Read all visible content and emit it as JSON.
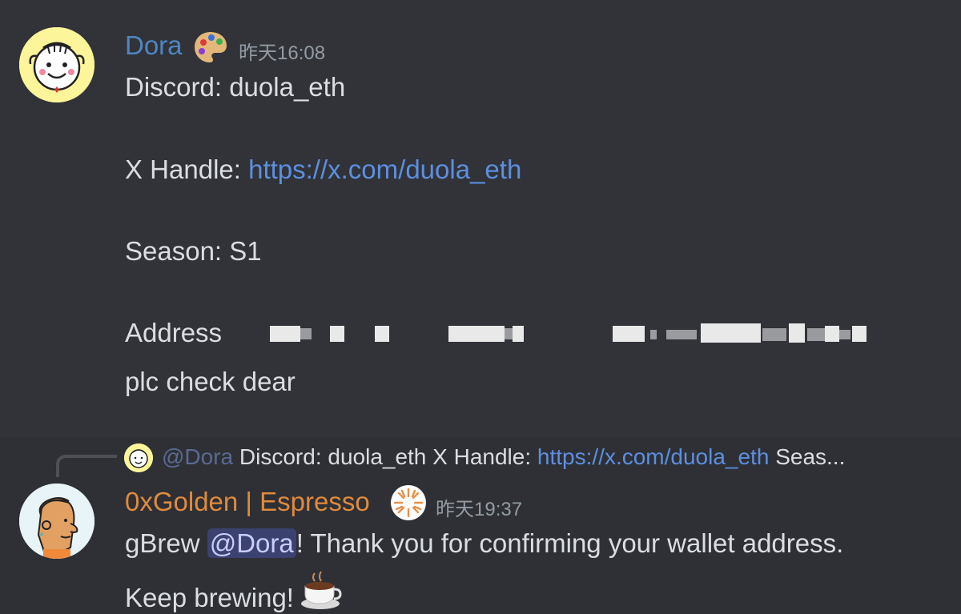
{
  "message1": {
    "username": "Dora",
    "timestamp": "昨天16:08",
    "lines": {
      "discord": "Discord: duola_eth",
      "x_handle_label": "X Handle: ",
      "x_handle_link": "https://x.com/duola_eth",
      "season": "Season: S1",
      "address_label": "Address",
      "check": "plc check dear"
    },
    "role_icon": "palette-icon"
  },
  "message2": {
    "reply": {
      "mention": "@Dora",
      "preview_text": "Discord: duola_eth  X Handle: ",
      "preview_link": "https://x.com/duola_eth",
      "preview_tail": "  Seas..."
    },
    "username": "0xGolden | Espresso",
    "timestamp": "昨天19:37",
    "role_icon": "sunburst-icon",
    "text_prefix": "gBrew ",
    "mention": "@Dora",
    "text_suffix": "! Thank you for confirming your wallet address.",
    "line2": "Keep brewing!",
    "emoji": "coffee-cup-icon"
  },
  "colors": {
    "background": "#313338",
    "username_dora": "#4e86c4",
    "username_golden": "#e08a3c",
    "link": "#5d8fe0",
    "mention_bg": "#3c4270"
  }
}
